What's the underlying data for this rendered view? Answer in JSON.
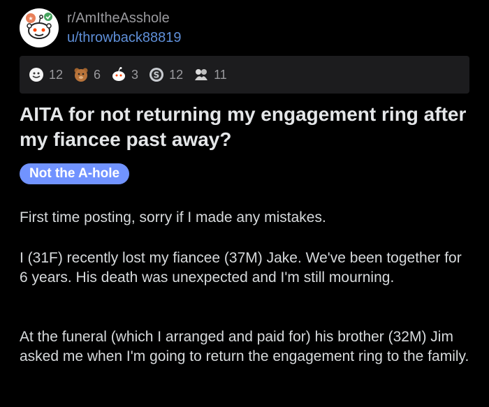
{
  "post": {
    "subreddit": "r/AmItheAsshole",
    "username": "u/throwback88819",
    "awards": [
      {
        "icon": "wholesome-award-icon",
        "count": "12"
      },
      {
        "icon": "bear-award-icon",
        "count": "6"
      },
      {
        "icon": "snoo-face-award-icon",
        "count": "3"
      },
      {
        "icon": "silver-award-icon",
        "count": "12"
      },
      {
        "icon": "hug-award-icon",
        "count": "11"
      }
    ],
    "title": "AITA for not returning my engagement ring after my fiancee past away?",
    "flair": "Not the A-hole",
    "paragraphs": [
      "First time posting, sorry if I made any mistakes.",
      "I (31F) recently lost my fiancee (37M) Jake. We've been together for 6 years. His death was unexpected and I'm still mourning.",
      "At the funeral (which I arranged and paid for) his brother (32M) Jim asked me when I'm going to return the engagement ring to the family."
    ]
  },
  "colors": {
    "background": "#000000",
    "flair_bg": "#7193ff",
    "username": "#5f8fd8",
    "muted": "#9a9a9e"
  }
}
